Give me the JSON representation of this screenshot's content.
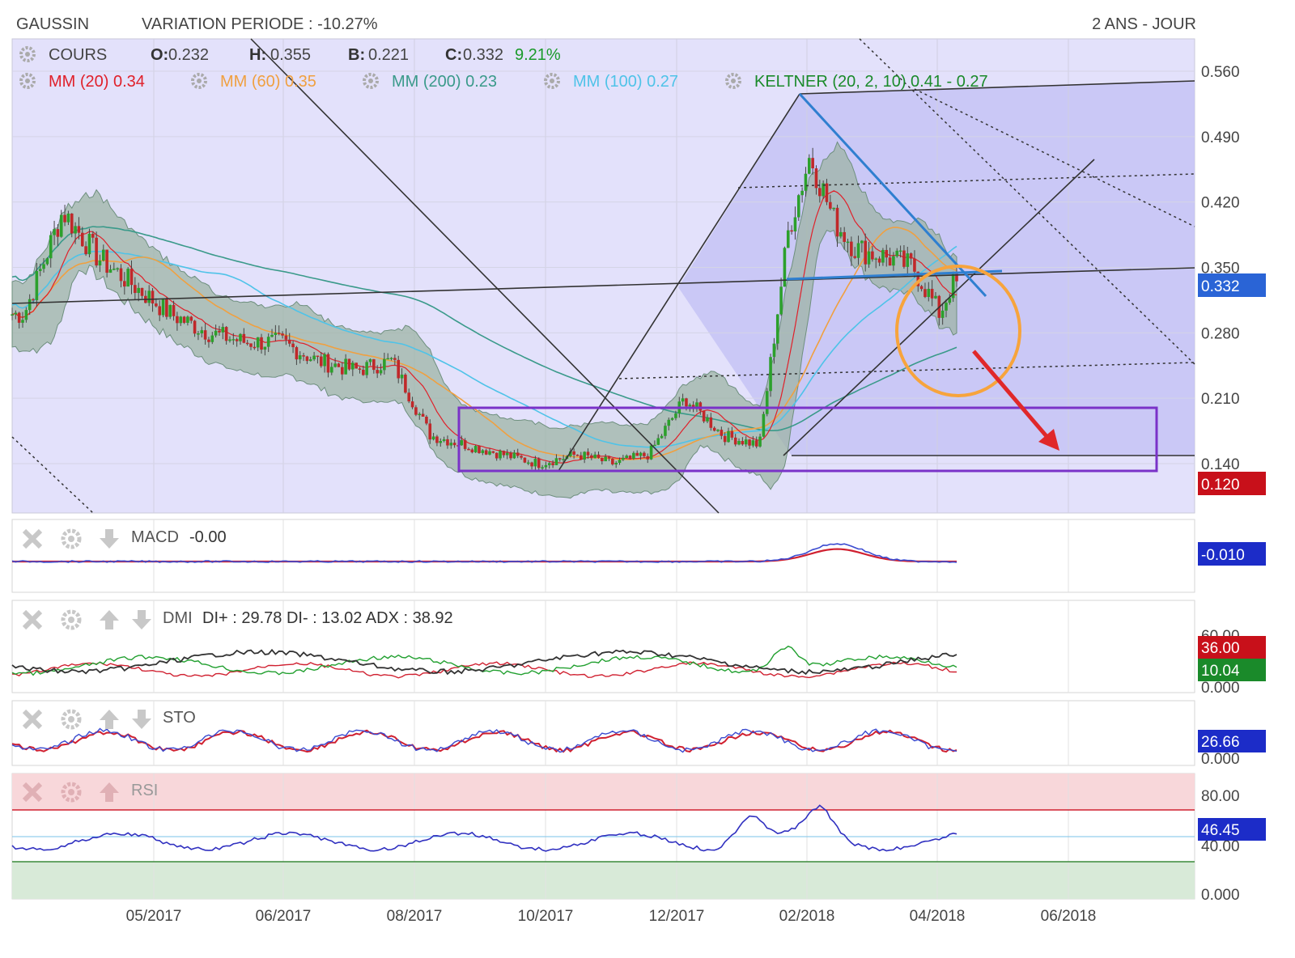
{
  "header": {
    "symbol": "GAUSSIN",
    "variation": "VARIATION PERIODE : -10.27%",
    "period": "2 ANS - JOUR"
  },
  "ohlc": {
    "cours_label": "COURS",
    "open_label": "O:",
    "open": "0.232",
    "high_label": "H:",
    "high": "0.355",
    "low_label": "B:",
    "low": "0.221",
    "close_label": "C:",
    "close": "0.332",
    "change": "9.21%"
  },
  "indicators": [
    {
      "label": "MM (20)",
      "value": "0.34",
      "color": "#e0202a"
    },
    {
      "label": "MM (60)",
      "value": "0.35",
      "color": "#f0a040"
    },
    {
      "label": "MM (200)",
      "value": "0.23",
      "color": "#3a9a8a"
    },
    {
      "label": "MM (100)",
      "value": "0.27",
      "color": "#4fc3e8"
    },
    {
      "label": "KELTNER (20, 2, 10)",
      "value": "0.41 - 0.27",
      "color": "#1a8a2a"
    }
  ],
  "price_axis": {
    "ticks": [
      "0.560",
      "0.490",
      "0.420",
      "0.350",
      "0.280",
      "0.210",
      "0.140"
    ],
    "current_badge": "0.332",
    "low_badge": "0.120"
  },
  "x_axis": {
    "ticks": [
      "05/2017",
      "06/2017",
      "08/2017",
      "10/2017",
      "12/2017",
      "02/2018",
      "04/2018",
      "06/2018"
    ]
  },
  "panels": {
    "macd": {
      "label": "MACD",
      "value": "-0.00",
      "badge": "-0.010"
    },
    "dmi": {
      "label": "DMI",
      "value": "DI+ : 29.78 DI- : 13.02 ADX : 38.92",
      "tick_top": "60.00",
      "tick_bottom": "0.000",
      "badge_red": "36.00",
      "badge_green": "10.04"
    },
    "sto": {
      "label": "STO",
      "tick_bottom": "0.000",
      "badge": "26.66"
    },
    "rsi": {
      "label": "RSI",
      "tick_top": "80.00",
      "tick_mid": "40.00",
      "tick_bottom": "0.000",
      "badge": "46.45"
    }
  },
  "colors": {
    "price_bg": "#e3e1fb",
    "channel_fill": "#c9c6f3",
    "keltner_fill": "#9cb8a8",
    "candle_up": "#2ca02c",
    "candle_down": "#c0282a",
    "rect": "#7a32c8",
    "circle": "#f7a43c",
    "arrow": "#e0282a",
    "blue_line": "#2f7fd0",
    "rsi_overbought": "#f8d7da",
    "rsi_oversold": "#d8ead8"
  },
  "chart_data": {
    "type": "line",
    "title": "GAUSSIN",
    "ylim": [
      0.1,
      0.58
    ],
    "x": [
      "2017-03-20",
      "2017-04-05",
      "2017-04-20",
      "2017-05-05",
      "2017-05-20",
      "2017-06-05",
      "2017-06-20",
      "2017-07-05",
      "2017-07-20",
      "2017-08-05",
      "2017-08-20",
      "2017-09-05",
      "2017-09-20",
      "2017-10-05",
      "2017-10-20",
      "2017-11-05",
      "2017-11-20",
      "2017-12-05",
      "2017-12-20",
      "2018-01-05",
      "2018-01-20",
      "2018-02-01",
      "2018-02-10",
      "2018-02-20",
      "2018-03-01",
      "2018-03-15",
      "2018-03-25",
      "2018-04-05",
      "2018-04-10"
    ],
    "series": [
      {
        "values": [
          0.3,
          0.41,
          0.36,
          0.33,
          0.3,
          0.28,
          0.27,
          0.27,
          0.25,
          0.24,
          0.25,
          0.17,
          0.16,
          0.15,
          0.14,
          0.15,
          0.14,
          0.15,
          0.21,
          0.17,
          0.16,
          0.39,
          0.47,
          0.4,
          0.37,
          0.36,
          0.35,
          0.3,
          0.332
        ]
      }
    ]
  }
}
